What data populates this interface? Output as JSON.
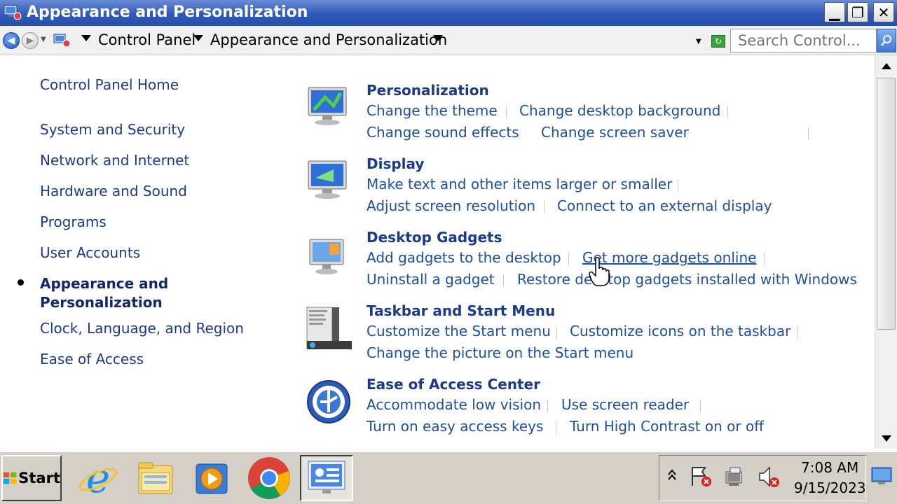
{
  "window": {
    "title": "Appearance and Personalization",
    "buttons": {
      "minimize": "▁",
      "maximize": "❐",
      "close": "✕"
    }
  },
  "addressbar": {
    "breadcrumbs": [
      "Control Panel",
      "Appearance and Personalization"
    ],
    "search_placeholder": "Search Control..."
  },
  "leftnav": {
    "items": [
      "Control Panel Home",
      "System and Security",
      "Network and Internet",
      "Hardware and Sound",
      "Programs",
      "User Accounts"
    ],
    "current": "Appearance and Personalization",
    "items_after": [
      "Clock, Language, and Region",
      "Ease of Access"
    ]
  },
  "categories": [
    {
      "title": "Personalization",
      "icon": "personalization-icon",
      "rows": [
        [
          "Change the theme",
          "Change desktop background"
        ],
        [
          "Change sound effects",
          "Change screen saver"
        ]
      ]
    },
    {
      "title": "Display",
      "icon": "display-icon",
      "rows": [
        [
          "Make text and other items larger or smaller"
        ],
        [
          "Adjust screen resolution",
          "Connect to an external display"
        ]
      ]
    },
    {
      "title": "Desktop Gadgets",
      "icon": "gadgets-icon",
      "rows": [
        [
          "Add gadgets to the desktop",
          "Get more gadgets online"
        ],
        [
          "Uninstall a gadget",
          "Restore desktop gadgets installed with Windows"
        ]
      ]
    },
    {
      "title": "Taskbar and Start Menu",
      "icon": "taskbar-icon",
      "rows": [
        [
          "Customize the Start menu",
          "Customize icons on the taskbar"
        ],
        [
          "Change the picture on the Start menu"
        ]
      ]
    },
    {
      "title": "Ease of Access Center",
      "icon": "ease-of-access-icon",
      "rows": [
        [
          "Accommodate low vision",
          "Use screen reader"
        ],
        [
          "Turn on easy access keys",
          "Turn High Contrast on or off"
        ]
      ]
    }
  ],
  "taskbar": {
    "start_label": "Start",
    "apps": [
      "internet-explorer-icon",
      "file-explorer-icon",
      "media-player-icon",
      "chrome-icon",
      "control-panel-icon"
    ],
    "clock": {
      "time": "7:08 AM",
      "date": "9/15/2023"
    }
  },
  "colors": {
    "link": "#1e4fa0",
    "heading": "#1c3a8a",
    "titlebar": "#2f59b8"
  }
}
